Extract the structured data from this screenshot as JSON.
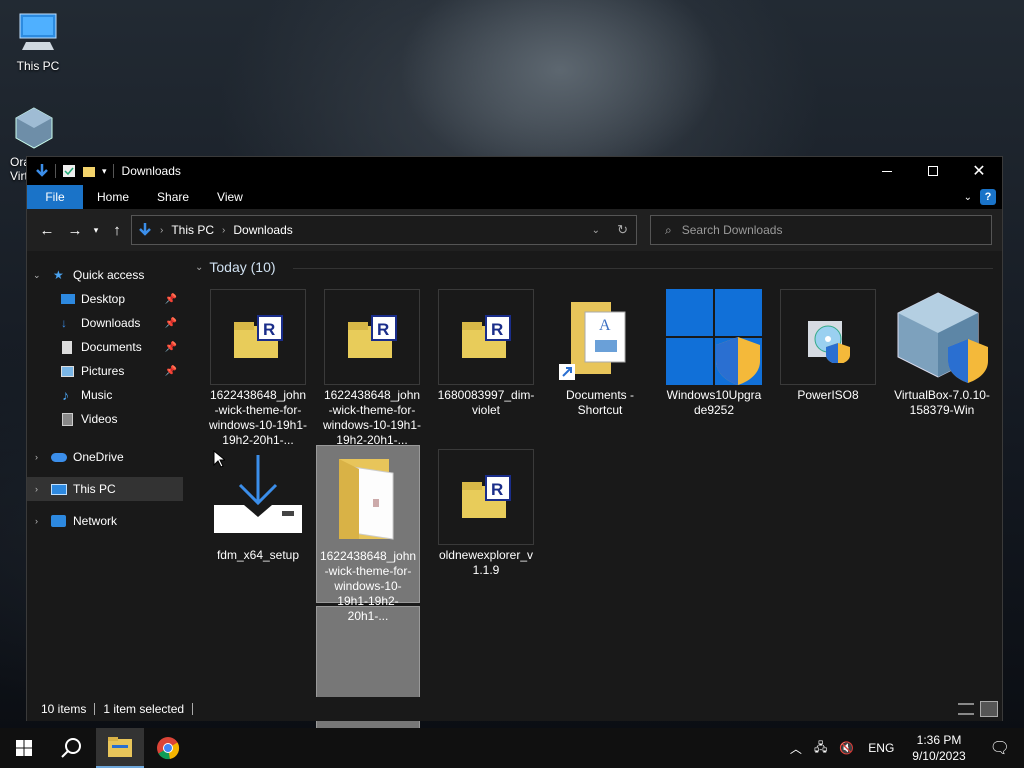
{
  "desktop": {
    "icons": [
      {
        "label": "This PC"
      },
      {
        "label": "Ora\nVirt"
      }
    ]
  },
  "window": {
    "title": "Downloads",
    "ribbon_tabs": [
      "File",
      "Home",
      "Share",
      "View"
    ],
    "address": {
      "segments": [
        "This PC",
        "Downloads"
      ]
    },
    "search_placeholder": "Search Downloads"
  },
  "nav_pane": {
    "quick_access": "Quick access",
    "quick_items": [
      {
        "label": "Desktop",
        "icon": "desktop-icon"
      },
      {
        "label": "Downloads",
        "icon": "downloads-icon"
      },
      {
        "label": "Documents",
        "icon": "documents-icon"
      },
      {
        "label": "Pictures",
        "icon": "pictures-icon"
      },
      {
        "label": "Music",
        "icon": "music-icon"
      },
      {
        "label": "Videos",
        "icon": "videos-icon"
      }
    ],
    "onedrive": "OneDrive",
    "this_pc": "This PC",
    "network": "Network"
  },
  "content": {
    "group_header": "Today (10)",
    "files": [
      {
        "name": "1622438648_john-wick-theme-for-windows-10-19h1-19h2-20h1-...",
        "icon": "winrar-archive-icon"
      },
      {
        "name": "1622438648_john-wick-theme-for-windows-10-19h1-19h2-20h1-...",
        "icon": "winrar-archive-icon"
      },
      {
        "name": "1680083997_dim-violet",
        "icon": "winrar-archive-icon"
      },
      {
        "name": "Documents - Shortcut",
        "icon": "folder-shortcut-icon"
      },
      {
        "name": "Windows10Upgrade9252",
        "icon": "windows-upgrade-icon"
      },
      {
        "name": "PowerISO8",
        "icon": "poweriso-installer-icon"
      },
      {
        "name": "VirtualBox-7.0.10-158379-Win",
        "icon": "virtualbox-installer-icon"
      },
      {
        "name": "fdm_x64_setup",
        "icon": "fdm-installer-icon"
      },
      {
        "name": "1622438648_john-wick-theme-for-windows-10-19h1-19h2-20h1-...",
        "icon": "folder-icon"
      },
      {
        "name": "oldnewexplorer_v1.1.9",
        "icon": "winrar-archive-icon"
      }
    ]
  },
  "status": {
    "count": "10 items",
    "selected": "1 item selected"
  },
  "taskbar": {
    "language": "ENG",
    "time": "1:36 PM",
    "date": "9/10/2023"
  },
  "colors": {
    "accent": "#1a73c8",
    "window_bg": "#191919",
    "selected_tile": "#777777"
  }
}
